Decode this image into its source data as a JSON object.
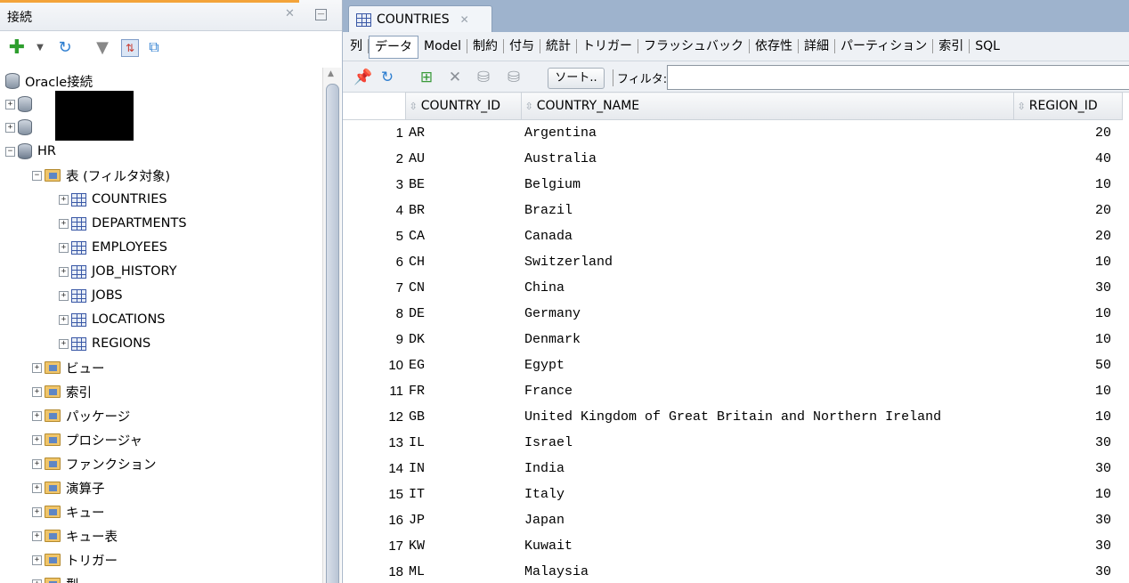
{
  "connections_panel": {
    "title": "接続",
    "root": "Oracle接続",
    "hr": "HR",
    "tables_folder": "表 (フィルタ対象)",
    "tables": [
      "COUNTRIES",
      "DEPARTMENTS",
      "EMPLOYEES",
      "JOB_HISTORY",
      "JOBS",
      "LOCATIONS",
      "REGIONS"
    ],
    "folders": [
      "ビュー",
      "索引",
      "パッケージ",
      "プロシージャ",
      "ファンクション",
      "演算子",
      "キュー",
      "キュー表",
      "トリガー",
      "型"
    ]
  },
  "editor": {
    "tab_title": "COUNTRIES",
    "subtabs": [
      "列",
      "データ",
      "Model",
      "制約",
      "付与",
      "統計",
      "トリガー",
      "フラッシュバック",
      "依存性",
      "詳細",
      "パーティション",
      "索引",
      "SQL"
    ],
    "active_subtab": "データ",
    "sort_label": "ソート..",
    "filter_label": "フィルタ:",
    "filter_value": ""
  },
  "grid": {
    "columns": [
      "COUNTRY_ID",
      "COUNTRY_NAME",
      "REGION_ID"
    ],
    "rows": [
      [
        "1",
        "AR",
        "Argentina",
        "20"
      ],
      [
        "2",
        "AU",
        "Australia",
        "40"
      ],
      [
        "3",
        "BE",
        "Belgium",
        "10"
      ],
      [
        "4",
        "BR",
        "Brazil",
        "20"
      ],
      [
        "5",
        "CA",
        "Canada",
        "20"
      ],
      [
        "6",
        "CH",
        "Switzerland",
        "10"
      ],
      [
        "7",
        "CN",
        "China",
        "30"
      ],
      [
        "8",
        "DE",
        "Germany",
        "10"
      ],
      [
        "9",
        "DK",
        "Denmark",
        "10"
      ],
      [
        "10",
        "EG",
        "Egypt",
        "50"
      ],
      [
        "11",
        "FR",
        "France",
        "10"
      ],
      [
        "12",
        "GB",
        "United Kingdom of Great Britain and Northern Ireland",
        "10"
      ],
      [
        "13",
        "IL",
        "Israel",
        "30"
      ],
      [
        "14",
        "IN",
        "India",
        "30"
      ],
      [
        "15",
        "IT",
        "Italy",
        "10"
      ],
      [
        "16",
        "JP",
        "Japan",
        "30"
      ],
      [
        "17",
        "KW",
        "Kuwait",
        "30"
      ],
      [
        "18",
        "ML",
        "Malaysia",
        "30"
      ]
    ]
  }
}
